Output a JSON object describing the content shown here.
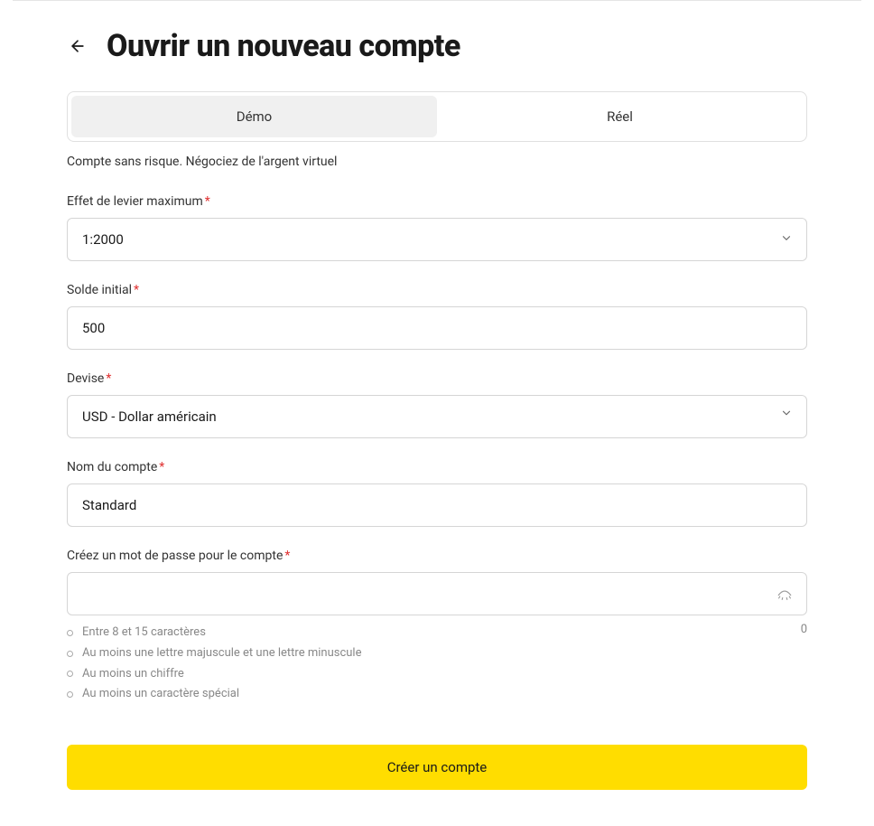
{
  "header": {
    "title": "Ouvrir un nouveau compte"
  },
  "tabs": {
    "demo": "Démo",
    "reel": "Réel",
    "description": "Compte sans risque. Négociez de l'argent virtuel"
  },
  "form": {
    "leverage": {
      "label": "Effet de levier maximum",
      "value": "1:2000"
    },
    "initial_balance": {
      "label": "Solde initial",
      "value": "500"
    },
    "currency": {
      "label": "Devise",
      "value": "USD - Dollar américain"
    },
    "account_name": {
      "label": "Nom du compte",
      "value": "Standard"
    },
    "password": {
      "label": "Créez un mot de passe pour le compte",
      "value": "",
      "char_count": "0",
      "requirements": [
        "Entre 8 et 15 caractères",
        "Au moins une lettre majuscule et une lettre minuscule",
        "Au moins un chiffre",
        "Au moins un caractère spécial"
      ]
    }
  },
  "submit": {
    "label": "Créer un compte"
  }
}
